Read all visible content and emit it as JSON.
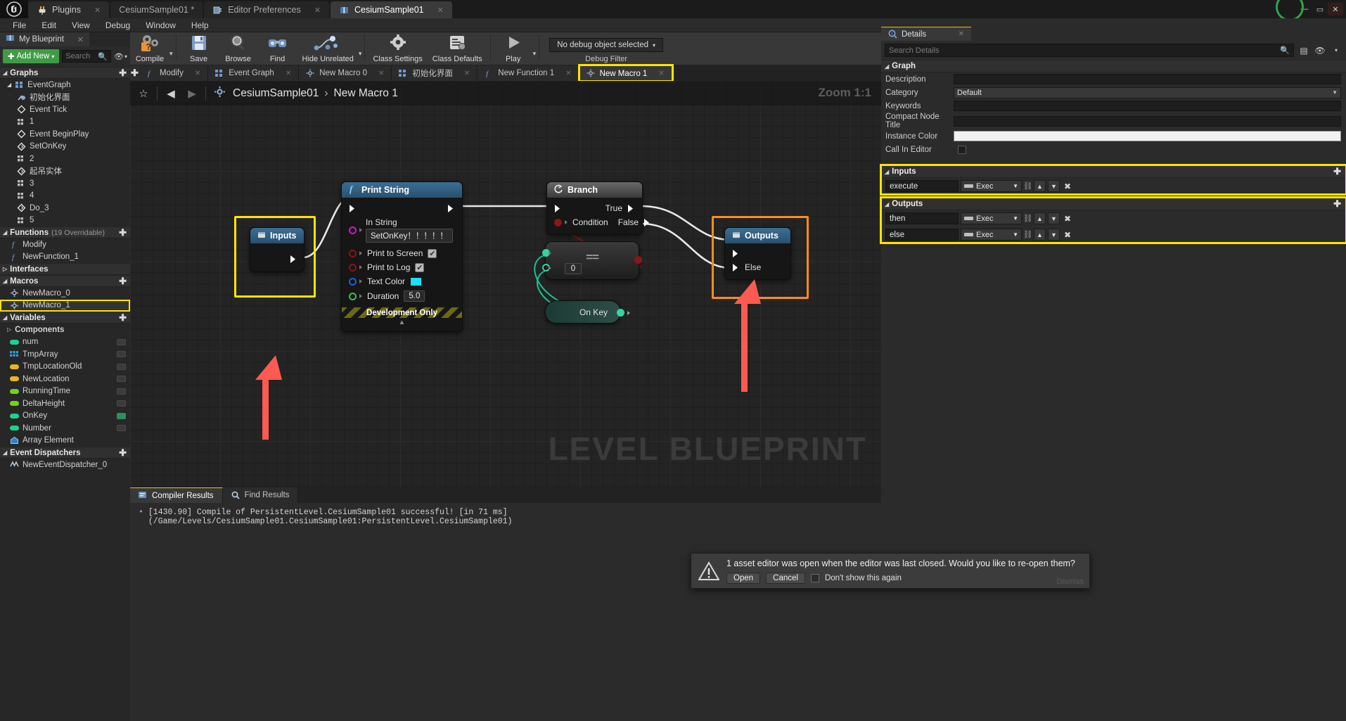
{
  "titlebar": {
    "tabs": [
      {
        "label": "Plugins",
        "icon": "plug-icon",
        "active": false,
        "dim": false
      },
      {
        "label": "CesiumSample01 *",
        "icon": "none",
        "active": false,
        "dim": true
      },
      {
        "label": "Editor Preferences",
        "icon": "prefs-icon",
        "active": false,
        "dim": true
      },
      {
        "label": "CesiumSample01",
        "icon": "blueprint-icon",
        "active": true,
        "dim": false
      }
    ],
    "window_buttons": [
      "minimize",
      "maximize",
      "close"
    ]
  },
  "menubar": {
    "items": [
      "File",
      "Edit",
      "View",
      "Debug",
      "Window",
      "Help"
    ]
  },
  "left_panel": {
    "tab_label": "My Blueprint",
    "add_new_label": "Add New",
    "search_placeholder": "Search",
    "sections": [
      {
        "name": "Graphs",
        "count": "",
        "items": [
          {
            "label": "EventGraph",
            "icon": "graph-icon",
            "indent": 0
          },
          {
            "label": "初始化界面",
            "icon": "comment-icon",
            "indent": 2
          },
          {
            "label": "Event Tick",
            "icon": "event-icon",
            "indent": 1
          },
          {
            "label": "1",
            "icon": "graph-icon",
            "indent": 1
          },
          {
            "label": "Event BeginPlay",
            "icon": "event-icon",
            "indent": 1
          },
          {
            "label": "SetOnKey",
            "icon": "event-icon",
            "indent": 1
          },
          {
            "label": "2",
            "icon": "graph-icon",
            "indent": 1
          },
          {
            "label": "起吊实体",
            "icon": "event-icon",
            "indent": 1
          },
          {
            "label": "3",
            "icon": "graph-icon",
            "indent": 1
          },
          {
            "label": "4",
            "icon": "graph-icon",
            "indent": 1
          },
          {
            "label": "Do_3",
            "icon": "event-icon",
            "indent": 1
          },
          {
            "label": "5",
            "icon": "graph-icon",
            "indent": 1
          }
        ]
      },
      {
        "name": "Functions",
        "count": "(19 Overridable)",
        "items": [
          {
            "label": "Modify",
            "icon": "function-icon",
            "indent": 1
          },
          {
            "label": "NewFunction_1",
            "icon": "function-icon",
            "indent": 1
          }
        ]
      },
      {
        "name": "Interfaces",
        "count": "",
        "collapsed": true,
        "items": []
      },
      {
        "name": "Macros",
        "count": "",
        "items": [
          {
            "label": "NewMacro_0",
            "icon": "macro-icon",
            "indent": 1
          },
          {
            "label": "NewMacro_1",
            "icon": "macro-icon",
            "indent": 1,
            "selected": true
          }
        ]
      },
      {
        "name": "Variables",
        "count": "",
        "items": []
      }
    ],
    "components_label": "Components",
    "variables": [
      {
        "label": "num",
        "color": "#1fd18c"
      },
      {
        "label": "TmpArray",
        "color": "#1f9fe0",
        "array": true
      },
      {
        "label": "TmpLocationOld",
        "color": "#e6b520"
      },
      {
        "label": "NewLocation",
        "color": "#e6b520"
      },
      {
        "label": "RunningTime",
        "color": "#73d11f"
      },
      {
        "label": "DeltaHeight",
        "color": "#73d11f"
      },
      {
        "label": "OnKey",
        "color": "#1fd18c"
      },
      {
        "label": "Number",
        "color": "#1fd18c"
      },
      {
        "label": "Array Element",
        "color": "#2f7fd0",
        "object": true
      }
    ],
    "dispatchers_section": "Event Dispatchers",
    "dispatchers": [
      {
        "label": "NewEventDispatcher_0"
      }
    ]
  },
  "toolbar": {
    "buttons": [
      {
        "label": "Compile",
        "icon": "compile-icon",
        "has_arrow": true
      },
      {
        "label": "Save",
        "icon": "save-icon",
        "has_arrow": false
      },
      {
        "label": "Browse",
        "icon": "browse-icon",
        "has_arrow": false
      },
      {
        "label": "Find",
        "icon": "find-icon",
        "has_arrow": false
      },
      {
        "label": "Hide Unrelated",
        "icon": "hide-unrelated-icon",
        "has_arrow": true
      },
      {
        "label": "Class Settings",
        "icon": "class-settings-icon",
        "has_arrow": false
      },
      {
        "label": "Class Defaults",
        "icon": "class-defaults-icon",
        "has_arrow": false
      },
      {
        "label": "Play",
        "icon": "play-icon",
        "has_arrow": true
      }
    ],
    "debug_object": "No debug object selected",
    "debug_filter_label": "Debug Filter"
  },
  "graph_tabs": {
    "tabs": [
      {
        "label": "Modify",
        "icon": "function-icon",
        "active": false
      },
      {
        "label": "Event Graph",
        "icon": "graph-icon",
        "active": false
      },
      {
        "label": "New Macro 0",
        "icon": "macro-icon",
        "active": false
      },
      {
        "label": "初始化界面",
        "icon": "graph-icon",
        "active": false
      },
      {
        "label": "New Function 1",
        "icon": "function-icon",
        "active": false
      },
      {
        "label": "New Macro 1",
        "icon": "macro-icon",
        "active": true,
        "highlighted": true
      }
    ]
  },
  "canvas": {
    "breadcrumb": {
      "root": "CesiumSample01",
      "separator": "›",
      "current": "New Macro 1"
    },
    "zoom_label": "Zoom 1:1",
    "watermark": "LEVEL BLUEPRINT",
    "nodes": {
      "inputs_node": {
        "title": "Inputs",
        "highlighted": true
      },
      "print_string": {
        "title": "Print String",
        "in_string_label": "In String",
        "in_string_value": "SetOnKey！！！！！",
        "print_to_screen_label": "Print to Screen",
        "print_to_screen_checked": true,
        "print_to_log_label": "Print to Log",
        "print_to_log_checked": true,
        "text_color_label": "Text Color",
        "text_color_value": "#19e0ff",
        "duration_label": "Duration",
        "duration_value": "5.0",
        "footer": "Development Only"
      },
      "branch": {
        "title": "Branch",
        "condition_label": "Condition",
        "true_label": "True",
        "false_label": "False"
      },
      "equals": {
        "operator": "==",
        "value": "0"
      },
      "on_key": {
        "label": "On Key"
      },
      "outputs_node": {
        "title": "Outputs",
        "else_label": "Else",
        "highlighted": true
      }
    }
  },
  "results": {
    "tabs": [
      {
        "label": "Compiler Results",
        "icon": "compiler-icon",
        "active": true
      },
      {
        "label": "Find Results",
        "icon": "find-icon",
        "active": false
      }
    ],
    "log": "[1430.90] Compile of PersistentLevel.CesiumSample01 successful! [in 71 ms] (/Game/Levels/CesiumSample01.CesiumSample01:PersistentLevel.CesiumSample01)"
  },
  "details": {
    "tab_label": "Details",
    "search_placeholder": "Search Details",
    "graph_section": "Graph",
    "properties": [
      {
        "label": "Description",
        "type": "text",
        "value": ""
      },
      {
        "label": "Category",
        "type": "select",
        "value": "Default"
      },
      {
        "label": "Keywords",
        "type": "text",
        "value": ""
      },
      {
        "label": "Compact Node Title",
        "type": "text",
        "value": ""
      },
      {
        "label": "Instance Color",
        "type": "color",
        "value": "#ffffff"
      },
      {
        "label": "Call In Editor",
        "type": "checkbox",
        "value": false
      }
    ],
    "inputs_section": "Inputs",
    "inputs": [
      {
        "name": "execute",
        "type": "Exec"
      }
    ],
    "outputs_section": "Outputs",
    "outputs": [
      {
        "name": "then",
        "type": "Exec"
      },
      {
        "name": "else",
        "type": "Exec"
      }
    ]
  },
  "notification": {
    "message": "1 asset editor was open when the editor was last closed. Would you like to re-open them?",
    "open_label": "Open",
    "cancel_label": "Cancel",
    "dont_show_label": "Don't show this again",
    "dismiss_label": "Dismiss"
  },
  "colors": {
    "highlight": "#ffe400",
    "highlight_orange": "#ff8c1a",
    "arrow_red": "#ff5a52",
    "accent_green": "#3f9c46"
  }
}
